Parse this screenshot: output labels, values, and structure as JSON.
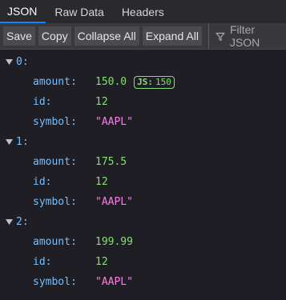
{
  "tabs": [
    {
      "label": "JSON",
      "active": true
    },
    {
      "label": "Raw Data",
      "active": false
    },
    {
      "label": "Headers",
      "active": false
    }
  ],
  "toolbar": {
    "save": "Save",
    "copy": "Copy",
    "collapse_all": "Collapse All",
    "expand_all": "Expand All",
    "filter_placeholder": "Filter JSON"
  },
  "icons": {
    "filter": "filter-icon",
    "expand": "chevron-down-icon"
  },
  "colors": {
    "key": "#75bfff",
    "number": "#86de74",
    "string": "#ff7de9",
    "accent": "#0a84ff"
  },
  "items": [
    {
      "index": "0:",
      "fields": [
        {
          "key": "amount:",
          "value": "150.0",
          "type": "num",
          "badge_label": "JS:",
          "badge_value": "150"
        },
        {
          "key": "id:",
          "value": "12",
          "type": "num"
        },
        {
          "key": "symbol:",
          "value": "\"AAPL\"",
          "type": "str"
        }
      ]
    },
    {
      "index": "1:",
      "fields": [
        {
          "key": "amount:",
          "value": "175.5",
          "type": "num"
        },
        {
          "key": "id:",
          "value": "12",
          "type": "num"
        },
        {
          "key": "symbol:",
          "value": "\"AAPL\"",
          "type": "str"
        }
      ]
    },
    {
      "index": "2:",
      "fields": [
        {
          "key": "amount:",
          "value": "199.99",
          "type": "num"
        },
        {
          "key": "id:",
          "value": "12",
          "type": "num"
        },
        {
          "key": "symbol:",
          "value": "\"AAPL\"",
          "type": "str"
        }
      ]
    }
  ]
}
